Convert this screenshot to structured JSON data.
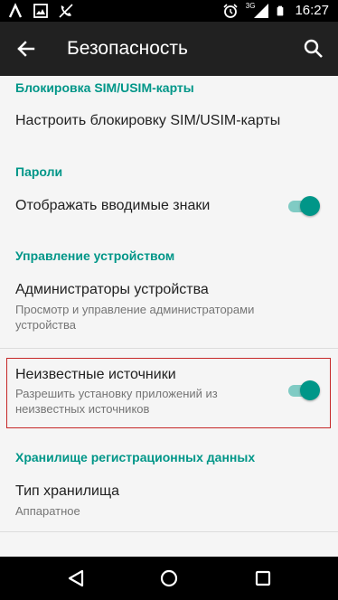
{
  "status_bar": {
    "time": "16:27",
    "network_type": "3G",
    "icons": [
      "lambda-icon",
      "image-icon",
      "call-off-icon",
      "alarm-icon",
      "signal-icon",
      "battery-icon"
    ]
  },
  "app_bar": {
    "title": "Безопасность",
    "back_icon": "arrow-back-icon",
    "search_icon": "search-icon"
  },
  "sections": {
    "sim_lock": {
      "category": "Блокировка SIM/USIM-карты",
      "item_title": "Настроить блокировку SIM/USIM-карты"
    },
    "passwords": {
      "category": "Пароли",
      "item_title": "Отображать вводимые знаки",
      "toggle_on": true
    },
    "device_admin": {
      "category": "Управление устройством",
      "admins_title": "Администраторы устройства",
      "admins_summary": "Просмотр и управление администраторами устройства",
      "unknown_title": "Неизвестные источники",
      "unknown_summary": "Разрешить установку приложений из неизвестных источников",
      "unknown_toggle_on": true
    },
    "credential_storage": {
      "category": "Хранилище регистрационных данных",
      "storage_title": "Тип хранилища",
      "storage_value": "Аппаратное"
    }
  },
  "colors": {
    "accent": "#009688",
    "toggle_track": "#80cbc4",
    "app_bar": "#212121",
    "highlight_border": "#c62828"
  },
  "nav_bar": {
    "icons": [
      "back-triangle-icon",
      "home-circle-icon",
      "recents-square-icon"
    ]
  }
}
